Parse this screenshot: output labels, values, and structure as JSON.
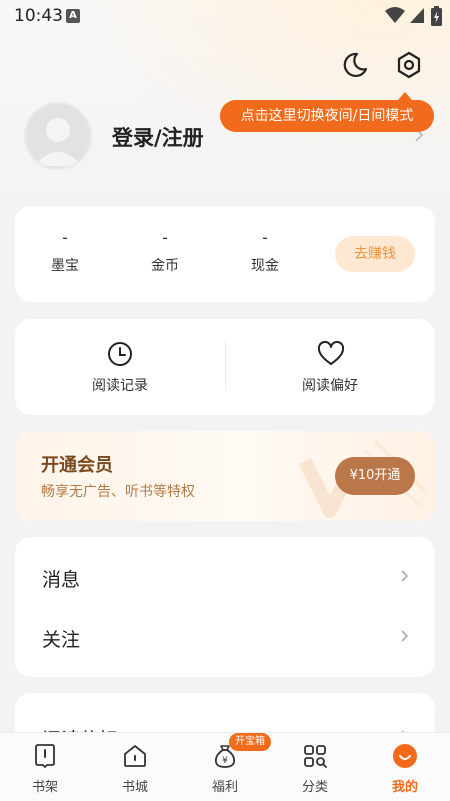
{
  "status_bar": {
    "time": "10:43",
    "notification_letter": "A"
  },
  "tooltip": {
    "text": "点击这里切换夜间/日间模式"
  },
  "profile": {
    "login_label": "登录/注册"
  },
  "wallet": {
    "stats": [
      {
        "value": "-",
        "label": "墨宝"
      },
      {
        "value": "-",
        "label": "金币"
      },
      {
        "value": "-",
        "label": "现金"
      }
    ],
    "earn_button": "去赚钱"
  },
  "shortcuts": [
    {
      "label": "阅读记录",
      "icon": "clock-icon"
    },
    {
      "label": "阅读偏好",
      "icon": "heart-icon"
    }
  ],
  "vip": {
    "title": "开通会员",
    "subtitle": "畅享无广告、听书等特权",
    "button": "¥10开通"
  },
  "menu": [
    {
      "label": "消息"
    },
    {
      "label": "关注"
    }
  ],
  "menu2": [
    {
      "label": "阅读偏好"
    }
  ],
  "bottom_nav": {
    "items": [
      {
        "label": "书架",
        "icon": "bookshelf-icon"
      },
      {
        "label": "书城",
        "icon": "bookstore-icon"
      },
      {
        "label": "福利",
        "icon": "welfare-bag-icon"
      },
      {
        "label": "分类",
        "icon": "category-grid-icon"
      },
      {
        "label": "我的",
        "icon": "profile-smile-icon"
      }
    ],
    "badge": "开宝箱",
    "accent": "#f26a1b"
  }
}
